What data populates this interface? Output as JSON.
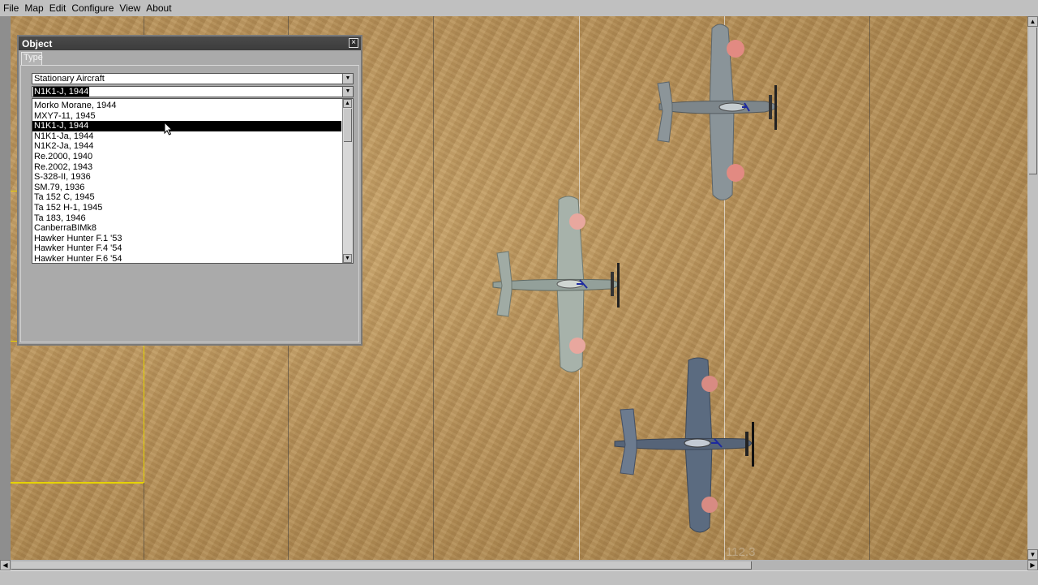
{
  "menubar": {
    "items": [
      "File",
      "Map",
      "Edit",
      "Configure",
      "View",
      "About"
    ]
  },
  "map": {
    "label": "112.3"
  },
  "object_panel": {
    "title": "Object",
    "close_glyph": "×",
    "tab_label": "Type",
    "category_combo": {
      "value": "Stationary Aircraft",
      "arrow": "▼"
    },
    "type_combo": {
      "value": "N1K1-J, 1944",
      "arrow": "▼"
    },
    "type_list": {
      "selected_value": "N1K1-J, 1944",
      "items": [
        "Morko Morane, 1944",
        "MXY7-11, 1945",
        "N1K1-J, 1944",
        "N1K1-Ja, 1944",
        "N1K2-Ja, 1944",
        "Re.2000, 1940",
        "Re.2002, 1943",
        "S-328-II, 1936",
        "SM.79, 1936",
        "Ta 152 C, 1945",
        "Ta 152 H-1, 1945",
        "Ta 183, 1946",
        "CanberraBIMk8",
        "Hawker Hunter F.1 '53",
        "Hawker Hunter F.4 '54",
        "Hawker Hunter F.6 '54"
      ]
    }
  },
  "icons": {
    "close": "close-icon",
    "dropdown": "chevron-down-icon",
    "scroll_up": "arrow-up-icon",
    "scroll_down": "arrow-down-icon",
    "scroll_left": "arrow-left-icon",
    "scroll_right": "arrow-right-icon",
    "cursor": "mouse-pointer-icon"
  },
  "colors": {
    "selection_bg": "#000000",
    "titlebar": "#444444",
    "map_grid_yellow": "#e6d200"
  }
}
